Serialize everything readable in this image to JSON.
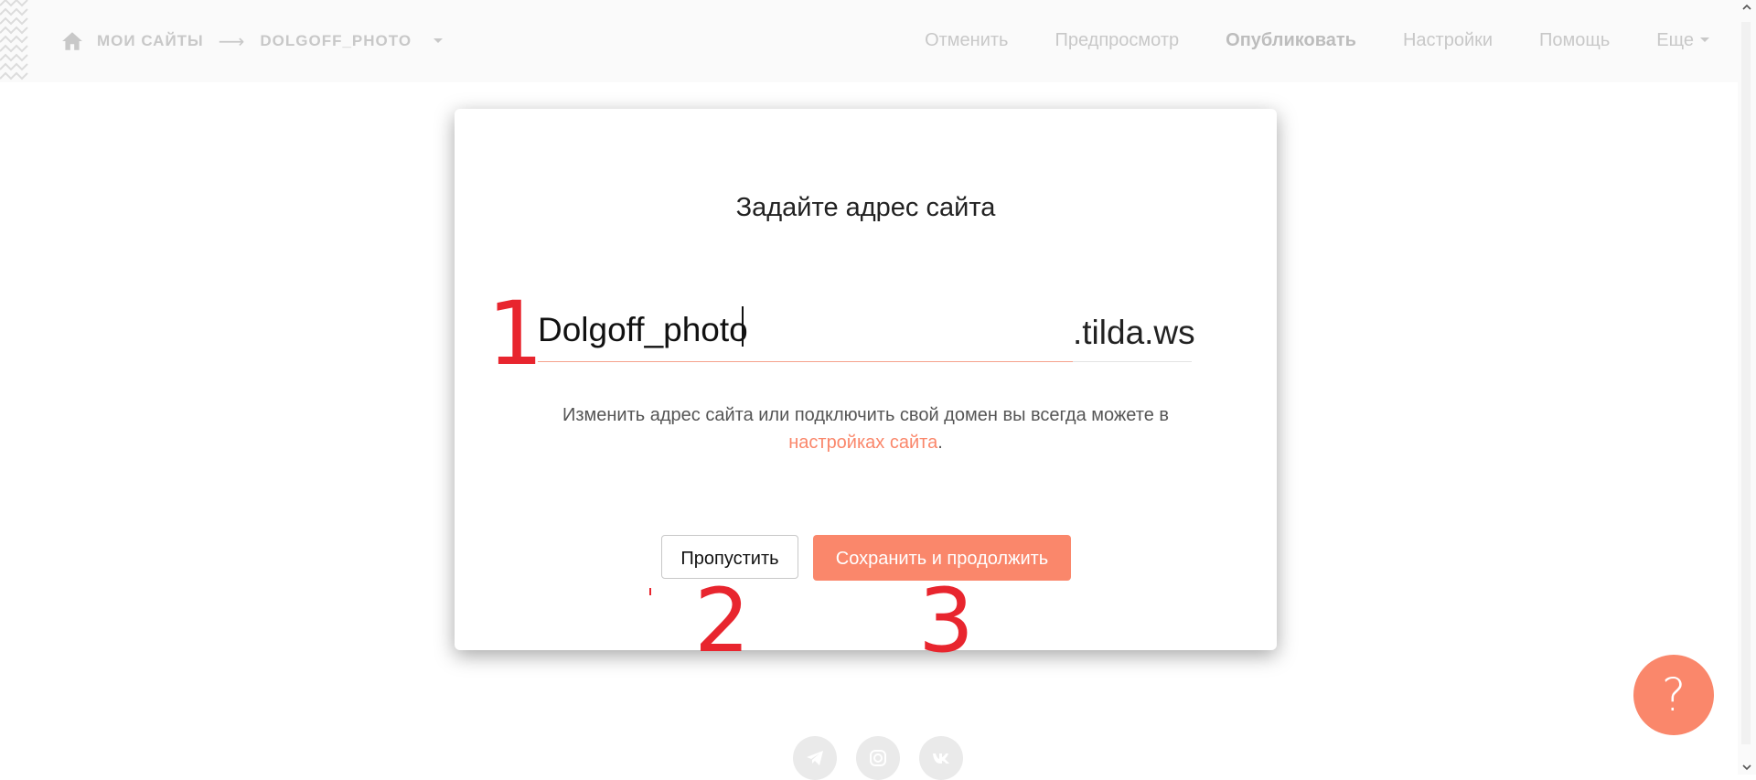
{
  "header": {
    "breadcrumb_root": "МОИ САЙТЫ",
    "breadcrumb_arrow": "⟶",
    "breadcrumb_site": "DOLGOFF_PHOTO",
    "nav": {
      "cancel": "Отменить",
      "preview": "Предпросмотр",
      "publish": "Опубликовать",
      "settings": "Настройки",
      "help": "Помощь",
      "more": "Еще"
    }
  },
  "modal": {
    "title": "Задайте адрес сайта",
    "domain_value": "Dolgoff_photo",
    "domain_suffix": ".tilda.ws",
    "hint_text": "Изменить адрес сайта или подключить свой домен вы всегда можете в",
    "hint_link": "настройках сайта",
    "hint_end": ".",
    "skip_label": "Пропустить",
    "save_label": "Сохранить и продолжить"
  },
  "annotations": {
    "one": "1",
    "two": "2",
    "three": "3"
  },
  "help_button": "?",
  "icons": {
    "home": "home-icon",
    "dropdown": "chevron-down-icon",
    "telegram": "telegram-icon",
    "instagram": "instagram-icon",
    "vk": "vk-icon"
  },
  "colors": {
    "accent": "#fa876b",
    "annotation": "#e8252e",
    "nav_text": "#c8c8c8"
  }
}
